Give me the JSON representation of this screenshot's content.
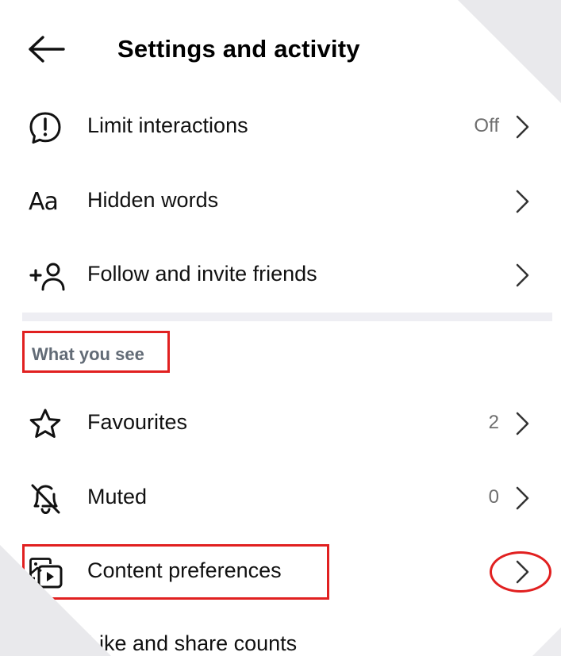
{
  "header": {
    "title": "Settings and activity",
    "back_icon": "arrow-left-icon"
  },
  "items_top": [
    {
      "label": "Limit interactions",
      "value": "Off",
      "icon": "limit-interactions-icon"
    },
    {
      "label": "Hidden words",
      "value": "",
      "icon": "hidden-words-icon"
    },
    {
      "label": "Follow and invite friends",
      "value": "",
      "icon": "add-person-icon"
    }
  ],
  "section": {
    "title": "What you see"
  },
  "items_section": [
    {
      "label": "Favourites",
      "value": "2",
      "icon": "star-icon"
    },
    {
      "label": "Muted",
      "value": "0",
      "icon": "bell-off-icon"
    },
    {
      "label": "Content preferences",
      "value": "",
      "icon": "content-preferences-icon"
    }
  ],
  "partial_item": {
    "label": "Like and share counts"
  },
  "colors": {
    "annotation": "#e12020",
    "section_title": "#626b76",
    "divider": "#eeeef3"
  }
}
